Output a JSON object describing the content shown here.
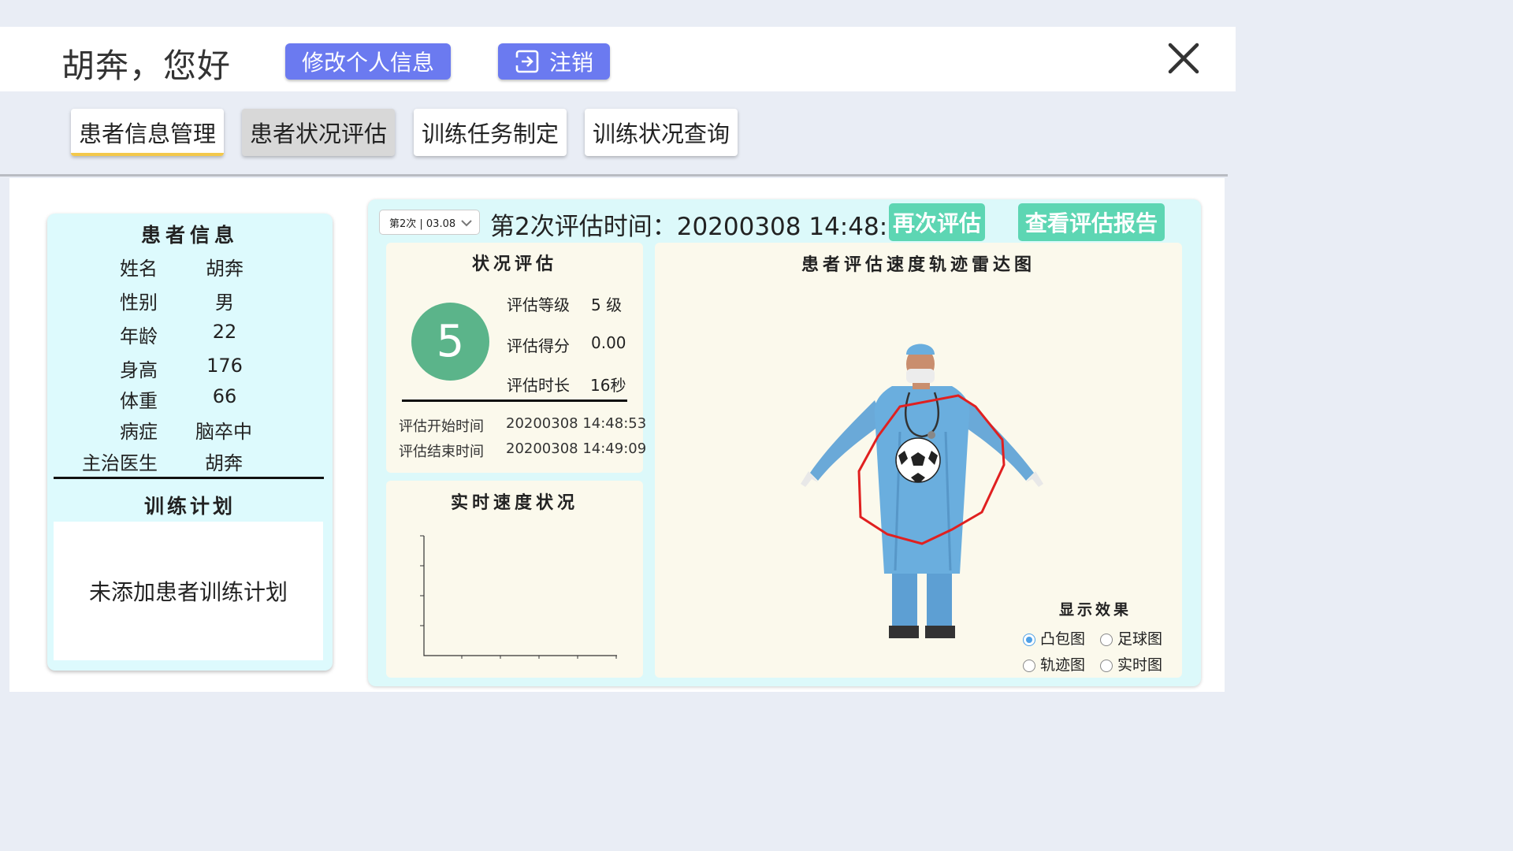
{
  "header": {
    "greeting": "胡奔，您好",
    "edit_profile": "修改个人信息",
    "logout": "注销"
  },
  "nav": {
    "tabs": [
      {
        "label": "患者信息管理"
      },
      {
        "label": "患者状况评估"
      },
      {
        "label": "训练任务制定"
      },
      {
        "label": "训练状况查询"
      }
    ]
  },
  "patient": {
    "title": "患者信息",
    "fields": [
      {
        "key": "姓名",
        "value": "胡奔"
      },
      {
        "key": "性别",
        "value": "男"
      },
      {
        "key": "年龄",
        "value": "22"
      },
      {
        "key": "身高",
        "value": "176"
      },
      {
        "key": "体重",
        "value": "66"
      },
      {
        "key": "病症",
        "value": "脑卒中"
      },
      {
        "key": "主治医生",
        "value": "胡奔"
      }
    ]
  },
  "plan": {
    "title": "训练计划",
    "empty_text": "未添加患者训练计划"
  },
  "evaluation": {
    "select_value": "第2次 | 03.08",
    "heading": "第2次评估时间：20200308 14:48:53",
    "reevaluate": "再次评估",
    "view_report": "查看评估报告"
  },
  "status": {
    "title": "状况评估",
    "level_number": "5",
    "level_label": "评估等级",
    "level_value": "5 级",
    "score_label": "评估得分",
    "score_value": "0.00",
    "duration_label": "评估时长",
    "duration_value": "16秒",
    "start_label": "评估开始时间",
    "start_value": "20200308 14:48:53",
    "end_label": "评估结束时间",
    "end_value": "20200308 14:49:09"
  },
  "speed": {
    "title": "实时速度状况"
  },
  "radar": {
    "title": "患者评估速度轨迹雷达图",
    "display_title": "显示效果",
    "options": [
      "凸包图",
      "足球图",
      "轨迹图",
      "实时图"
    ],
    "selected": "凸包图"
  },
  "colors": {
    "accent_button": "#6b7af0",
    "green_button": "#5dd6b3",
    "level_circle": "#5bb48a",
    "hull_line": "#e02020"
  }
}
